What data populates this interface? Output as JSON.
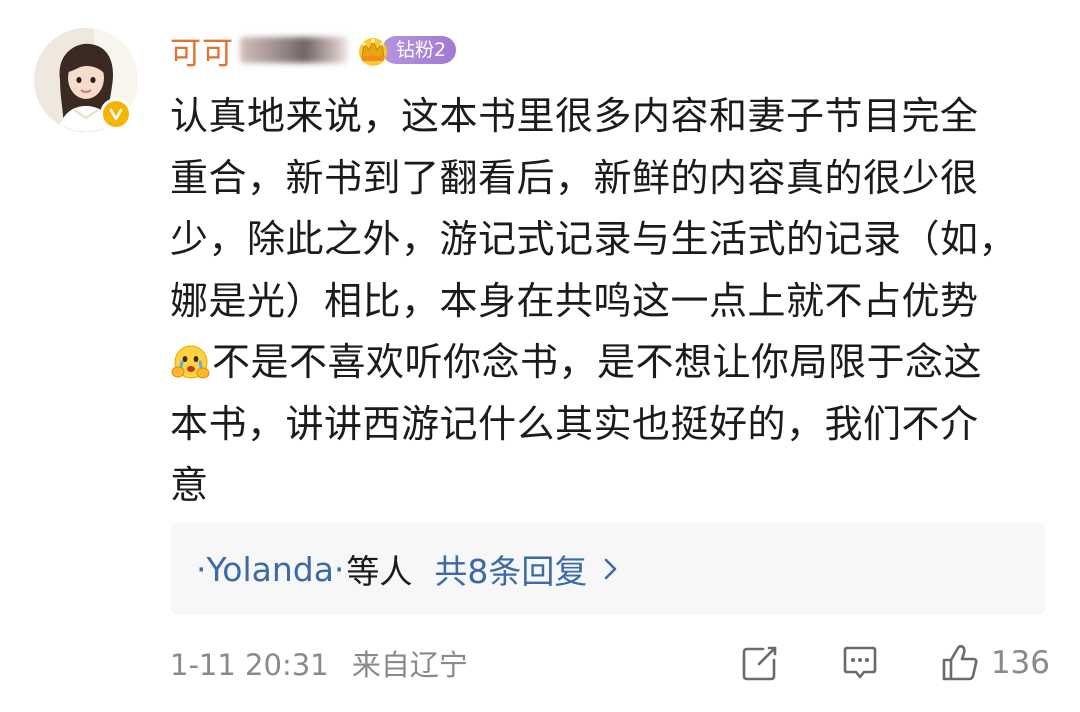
{
  "comment": {
    "username": "可可",
    "fan_badge": "钻粉2",
    "text_lines": [
      "认真地来说，这本书里很多内容和妻子节目完全",
      "重合，新书到了翻看后，新鲜的内容真的很少很",
      "少，除此之外，游记式记录与生活式的记录（如，",
      "娜是光）相比，本身在共鸣这一点上就不占优势"
    ],
    "text_line5_after_emoji": "不是不喜欢听你念书，是不想让你局限于念这",
    "text_tail_lines": [
      "本书，讲讲西游记什么其实也挺好的，我们不介",
      "意"
    ],
    "emoji_name": "crying-hug-emoji"
  },
  "replies": {
    "users": "·Yolanda·",
    "etc": "等人",
    "count": "共8条回复"
  },
  "footer": {
    "date": "1-11",
    "time": "20:31",
    "location": "来自辽宁",
    "like_count": "136"
  },
  "icons": {
    "verified": "verified-badge-icon",
    "crown": "crown-icon",
    "share": "share-icon",
    "comment": "comment-icon",
    "like": "thumbs-up-icon",
    "chevron": "chevron-right-icon"
  },
  "colors": {
    "username": "#e2732e",
    "link_blue": "#3b6aa8",
    "meta_gray": "#8a8a8a",
    "fan_badge_purple": "#a07ad3",
    "verified_gold": "#f5b400"
  }
}
